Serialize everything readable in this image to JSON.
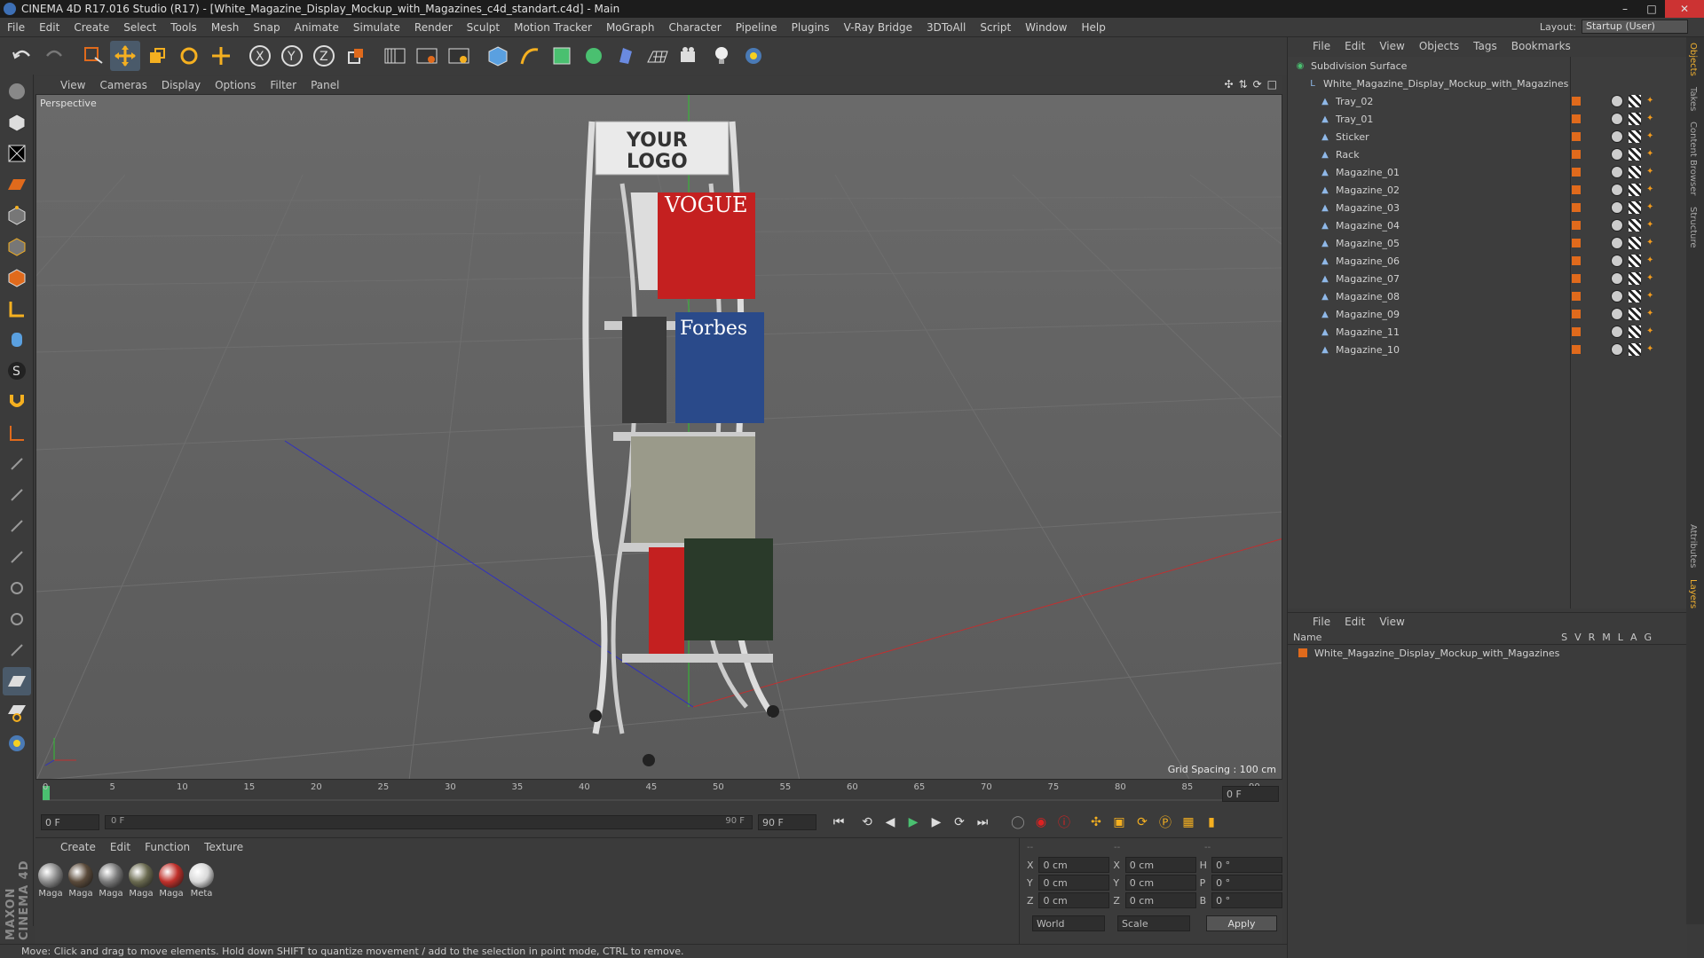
{
  "window": {
    "title": "CINEMA 4D R17.016 Studio (R17) - [White_Magazine_Display_Mockup_with_Magazines_c4d_standart.c4d] - Main"
  },
  "menu": [
    "File",
    "Edit",
    "Create",
    "Select",
    "Tools",
    "Mesh",
    "Snap",
    "Animate",
    "Simulate",
    "Render",
    "Sculpt",
    "Motion Tracker",
    "MoGraph",
    "Character",
    "Pipeline",
    "Plugins",
    "V-Ray Bridge",
    "3DToAll",
    "Script",
    "Window",
    "Help"
  ],
  "layout": {
    "label": "Layout:",
    "value": "Startup (User)"
  },
  "viewport": {
    "menu": [
      "View",
      "Cameras",
      "Display",
      "Options",
      "Filter",
      "Panel"
    ],
    "label": "Perspective",
    "grid_spacing": "Grid Spacing : 100 cm",
    "logo_line1": "YOUR",
    "logo_line2": "LOGO",
    "mag1": "VOGUE",
    "mag2": "Forbes"
  },
  "timeline": {
    "ticks": [
      "0",
      "5",
      "10",
      "15",
      "20",
      "25",
      "30",
      "35",
      "40",
      "45",
      "50",
      "55",
      "60",
      "65",
      "70",
      "75",
      "80",
      "85",
      "90"
    ],
    "end_field": "0 F",
    "start_field": "0 F",
    "range_start": "0 F",
    "range_end": "90 F",
    "max_field": "90 F"
  },
  "materials": {
    "menu": [
      "Create",
      "Edit",
      "Function",
      "Texture"
    ],
    "items": [
      {
        "label": "Maga",
        "color": "#8a8a8a"
      },
      {
        "label": "Maga",
        "color": "#5a4a3a"
      },
      {
        "label": "Maga",
        "color": "#7a7a7a"
      },
      {
        "label": "Maga",
        "color": "#6a6a50"
      },
      {
        "label": "Maga",
        "color": "#c0302a"
      },
      {
        "label": "Meta",
        "color": "#d8d8d8"
      }
    ]
  },
  "coords": {
    "header": [
      "--",
      "--",
      "--"
    ],
    "rows": [
      {
        "a": "X",
        "v1": "0 cm",
        "b": "X",
        "v2": "0 cm",
        "c": "H",
        "v3": "0 °"
      },
      {
        "a": "Y",
        "v1": "0 cm",
        "b": "Y",
        "v2": "0 cm",
        "c": "P",
        "v3": "0 °"
      },
      {
        "a": "Z",
        "v1": "0 cm",
        "b": "Z",
        "v2": "0 cm",
        "c": "B",
        "v3": "0 °"
      }
    ],
    "world": "World",
    "scale": "Scale",
    "apply": "Apply"
  },
  "status": "Move: Click and drag to move elements. Hold down SHIFT to quantize movement / add to the selection in point mode, CTRL to remove.",
  "objects_panel": {
    "menu": [
      "File",
      "Edit",
      "View",
      "Objects",
      "Tags",
      "Bookmarks"
    ],
    "root": "Subdivision Surface",
    "group": "White_Magazine_Display_Mockup_with_Magazines",
    "children": [
      "Tray_02",
      "Tray_01",
      "Sticker",
      "Rack",
      "Magazine_01",
      "Magazine_02",
      "Magazine_03",
      "Magazine_04",
      "Magazine_05",
      "Magazine_06",
      "Magazine_07",
      "Magazine_08",
      "Magazine_09",
      "Magazine_11",
      "Magazine_10"
    ]
  },
  "layers_panel": {
    "menu": [
      "File",
      "Edit",
      "View"
    ],
    "name_header": "Name",
    "cols": [
      "S",
      "V",
      "R",
      "M",
      "L",
      "A",
      "G"
    ],
    "layer": "White_Magazine_Display_Mockup_with_Magazines"
  },
  "side_tabs": [
    "Objects",
    "Takes",
    "Content Browser",
    "Structure",
    "Attributes",
    "Layers"
  ],
  "colors": {
    "accent": "#e06a1c",
    "x_axis": "#c03030",
    "z_axis": "#3030c0",
    "y_axis": "#30c030"
  }
}
